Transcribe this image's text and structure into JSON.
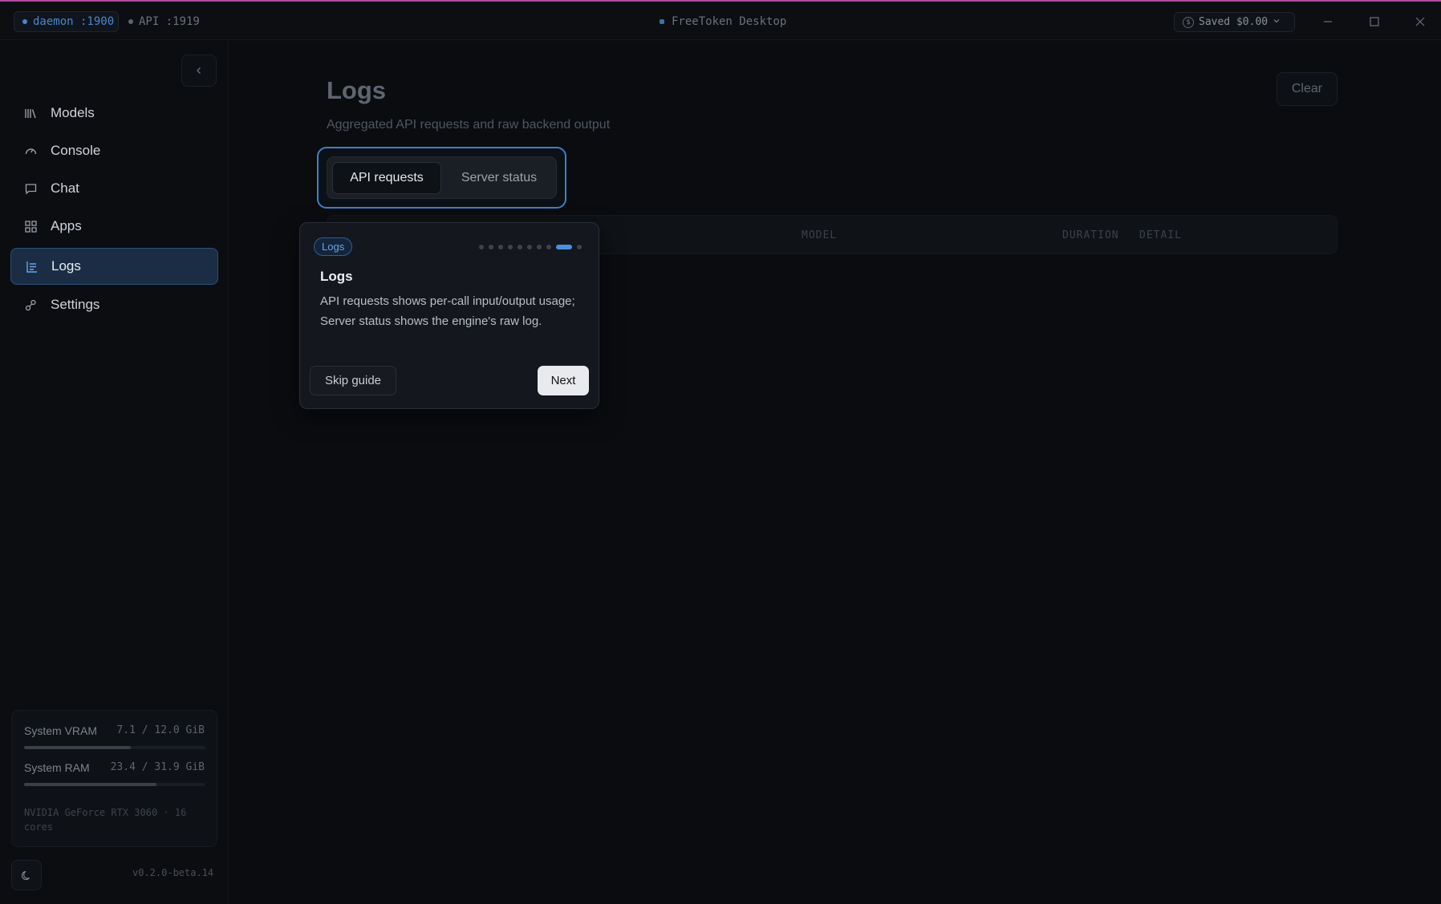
{
  "titlebar": {
    "daemon_label": "daemon :1900",
    "api_label": "API :1919",
    "app_title": "FreeToken Desktop",
    "saved_label": "Saved $0.00",
    "coin_symbol": "$",
    "colors": {
      "daemon": "#4a86c9",
      "api": "#5e6470",
      "title_dot": "#3f6fa6",
      "frame_top": "#b04a9c"
    }
  },
  "sidebar": {
    "items": [
      {
        "label": "Models",
        "icon": "library-icon"
      },
      {
        "label": "Console",
        "icon": "gauge-icon"
      },
      {
        "label": "Chat",
        "icon": "chat-icon"
      },
      {
        "label": "Apps",
        "icon": "grid-icon"
      },
      {
        "label": "Logs",
        "icon": "logs-icon",
        "active": true
      },
      {
        "label": "Settings",
        "icon": "settings-icon"
      }
    ],
    "system": {
      "vram_label": "System VRAM",
      "vram_value": "7.1 / 12.0 GiB",
      "vram_fraction": 0.59,
      "ram_label": "System RAM",
      "ram_value": "23.4 / 31.9 GiB",
      "ram_fraction": 0.73,
      "gpu_info": "NVIDIA GeForce RTX 3060 · 16 cores"
    },
    "version": "v0.2.0-beta.14"
  },
  "main": {
    "title": "Logs",
    "subtitle": "Aggregated API requests and raw backend output",
    "clear_label": "Clear",
    "tabs": [
      {
        "label": "API requests",
        "active": true
      },
      {
        "label": "Server status",
        "active": false
      }
    ],
    "table_headers": [
      "MODEL",
      "DURATION",
      "DETAIL"
    ]
  },
  "guide": {
    "badge": "Logs",
    "title": "Logs",
    "body": "API requests shows per-call input/output usage; Server status shows the engine's raw log.",
    "skip_label": "Skip guide",
    "next_label": "Next",
    "total_steps": 10,
    "current_step": 9,
    "accent": "#4a8fe0"
  }
}
